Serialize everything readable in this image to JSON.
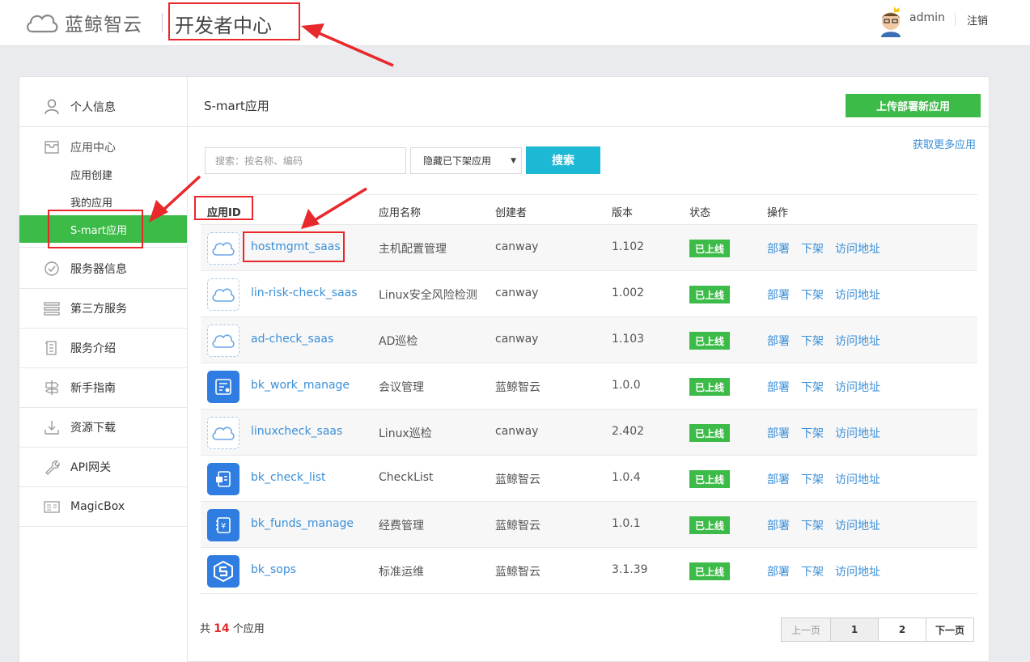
{
  "header": {
    "logo_text": "蓝鲸智云",
    "dev_center": "开发者中心",
    "user": "admin",
    "logout": "注销"
  },
  "sidebar": {
    "items": [
      {
        "label": "个人信息",
        "icon": "user-icon"
      },
      {
        "label": "服务器信息",
        "icon": "check-circle-icon"
      },
      {
        "label": "第三方服务",
        "icon": "list-icon"
      },
      {
        "label": "服务介绍",
        "icon": "document-icon"
      },
      {
        "label": "新手指南",
        "icon": "signpost-icon"
      },
      {
        "label": "资源下载",
        "icon": "download-icon"
      },
      {
        "label": "API网关",
        "icon": "wrench-icon"
      },
      {
        "label": "MagicBox",
        "icon": "box-icon"
      }
    ],
    "app_center": {
      "title": "应用中心",
      "subitems": [
        "应用创建",
        "我的应用",
        "S-mart应用"
      ],
      "active": "S-mart应用"
    }
  },
  "main": {
    "title": "S-mart应用",
    "upload_button": "上传部署新应用",
    "more_apps_link": "获取更多应用",
    "search_placeholder": "搜索：按名称、编码",
    "filter_value": "隐藏已下架应用",
    "search_button": "搜索",
    "columns": [
      "应用ID",
      "应用名称",
      "创建者",
      "版本",
      "状态",
      "操作"
    ],
    "rows": [
      {
        "id": "hostmgmt_saas",
        "name": "主机配置管理",
        "creator": "canway",
        "version": "1.102",
        "status": "已上线",
        "icon": "cloud-icon"
      },
      {
        "id": "lin-risk-check_saas",
        "name": "Linux安全风险检测",
        "creator": "canway",
        "version": "1.002",
        "status": "已上线",
        "icon": "cloud-icon"
      },
      {
        "id": "ad-check_saas",
        "name": "AD巡检",
        "creator": "canway",
        "version": "1.103",
        "status": "已上线",
        "icon": "cloud-icon"
      },
      {
        "id": "bk_work_manage",
        "name": "会议管理",
        "creator": "蓝鲸智云",
        "version": "1.0.0",
        "status": "已上线",
        "icon": "meeting-icon"
      },
      {
        "id": "linuxcheck_saas",
        "name": "Linux巡检",
        "creator": "canway",
        "version": "2.402",
        "status": "已上线",
        "icon": "cloud-icon"
      },
      {
        "id": "bk_check_list",
        "name": "CheckList",
        "creator": "蓝鲸智云",
        "version": "1.0.4",
        "status": "已上线",
        "icon": "checklist-icon"
      },
      {
        "id": "bk_funds_manage",
        "name": "经费管理",
        "creator": "蓝鲸智云",
        "version": "1.0.1",
        "status": "已上线",
        "icon": "funds-icon"
      },
      {
        "id": "bk_sops",
        "name": "标准运维",
        "creator": "蓝鲸智云",
        "version": "3.1.39",
        "status": "已上线",
        "icon": "sops-icon"
      }
    ],
    "row_actions": [
      "部署",
      "下架",
      "访问地址"
    ],
    "total_prefix": "共",
    "total_count": "14",
    "total_suffix": "个应用",
    "pagination": {
      "prev": "上一页",
      "pages": [
        "1",
        "2"
      ],
      "next": "下一页",
      "current": "1"
    }
  },
  "colors": {
    "accent_green": "#3dbb48",
    "search_blue": "#1cb8d4",
    "link_blue": "#3a8fd8",
    "annotation_red": "#e8282b"
  }
}
